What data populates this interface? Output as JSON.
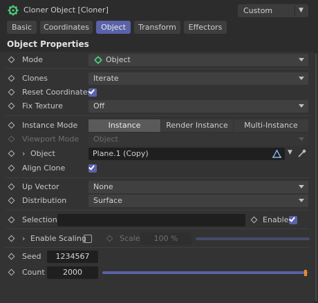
{
  "header": {
    "title": "Cloner Object [Cloner]",
    "preset": "Custom",
    "icon": "cloner-gear-icon"
  },
  "tabs": [
    {
      "label": "Basic",
      "active": false
    },
    {
      "label": "Coordinates",
      "active": false
    },
    {
      "label": "Object",
      "active": true
    },
    {
      "label": "Transform",
      "active": false
    },
    {
      "label": "Effectors",
      "active": false
    }
  ],
  "section": {
    "title": "Object Properties"
  },
  "mode": {
    "label": "Mode",
    "value": "Object",
    "icon": "cloner-gear-icon"
  },
  "clones": {
    "label": "Clones",
    "value": "Iterate"
  },
  "reset_coordinates": {
    "label": "Reset Coordinates",
    "checked": true
  },
  "fix_texture": {
    "label": "Fix Texture",
    "value": "Off"
  },
  "instance_mode": {
    "label": "Instance Mode",
    "options": [
      "Instance",
      "Render Instance",
      "Multi-Instance"
    ],
    "selected": "Instance"
  },
  "viewport_mode": {
    "label": "Viewport Mode",
    "value": "Object"
  },
  "object": {
    "label": "Object",
    "value": "Plane.1 (Copy)"
  },
  "align_clone": {
    "label": "Align Clone",
    "checked": true
  },
  "up_vector": {
    "label": "Up Vector",
    "value": "None"
  },
  "distribution": {
    "label": "Distribution",
    "value": "Surface"
  },
  "selection": {
    "label": "Selection",
    "value": "",
    "enable_label": "Enable",
    "enable_checked": true
  },
  "enable_scaling": {
    "label": "Enable Scaling",
    "checked": false,
    "scale_label": "Scale",
    "scale_value": "100 %"
  },
  "seed": {
    "label": "Seed",
    "value": "1234567"
  },
  "count": {
    "label": "Count",
    "value": "2000"
  },
  "colors": {
    "accent": "#5a62a8",
    "handle": "#e88a2c"
  }
}
